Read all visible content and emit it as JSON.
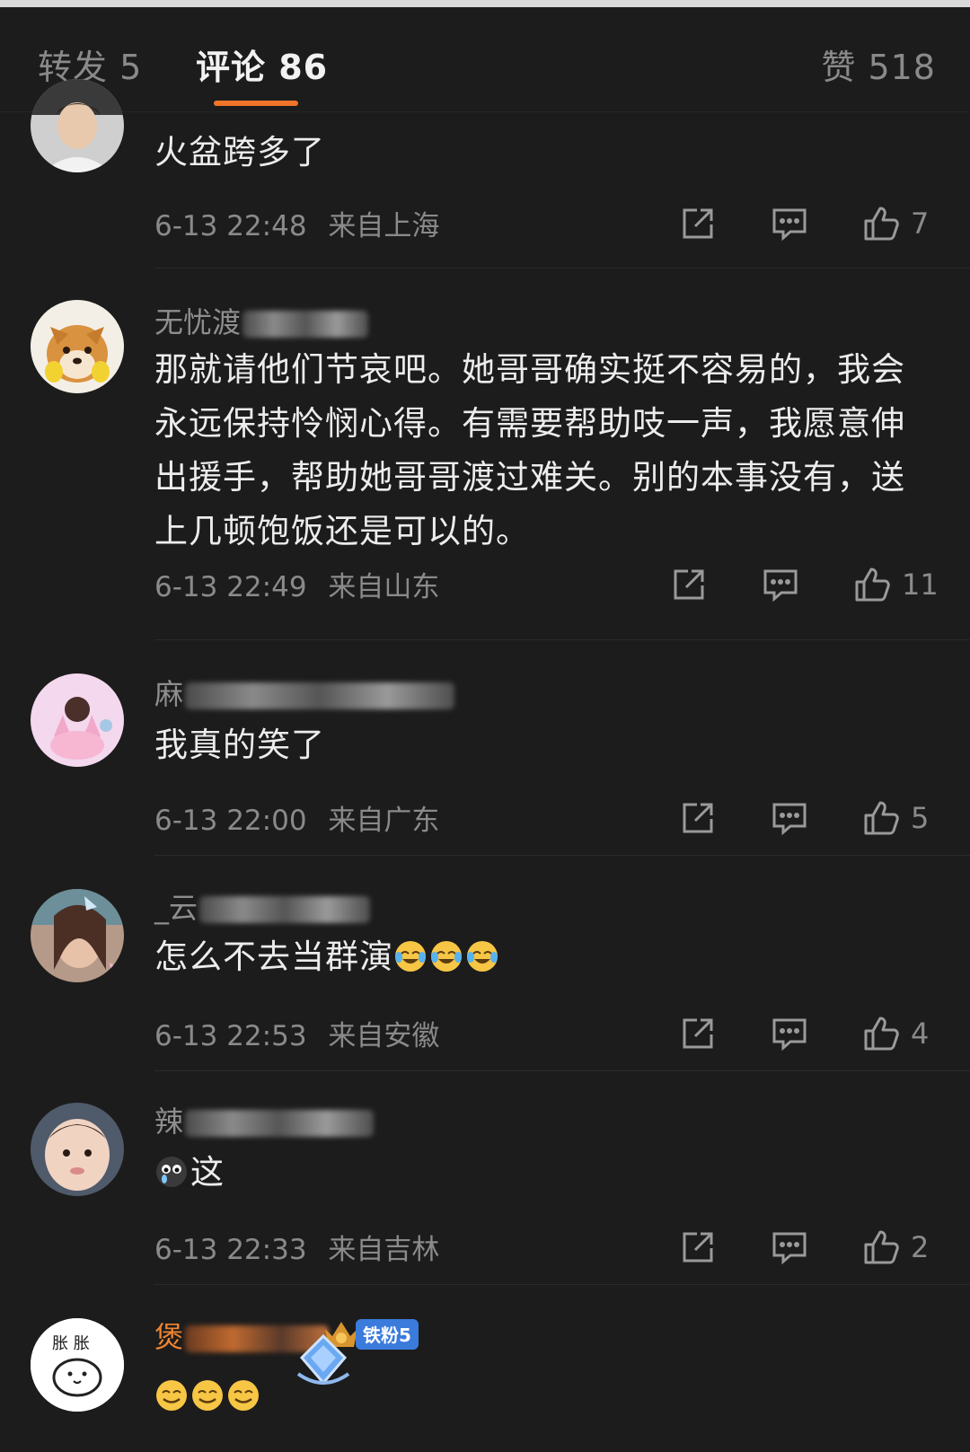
{
  "tabs": {
    "repost": "转发 5",
    "comments": "评论 86",
    "likes": "赞 518"
  },
  "comments": [
    {
      "username": "",
      "text": "火盆跨多了",
      "time": "6-13 22:48",
      "location": "来自上海",
      "likes": "7"
    },
    {
      "username": "无忧渡",
      "text": "那就请他们节哀吧。她哥哥确实挺不容易的，我会永远保持怜悯心得。有需要帮助吱一声，我愿意伸出援手，帮助她哥哥渡过难关。别的本事没有，送上几顿饱饭还是可以的。",
      "time": "6-13 22:49",
      "location": "来自山东",
      "likes": "11"
    },
    {
      "username": "麻",
      "text": "我真的笑了",
      "time": "6-13 22:00",
      "location": "来自广东",
      "likes": "5"
    },
    {
      "username": "_云",
      "text": "怎么不去当群演",
      "time": "6-13 22:53",
      "location": "来自安徽",
      "likes": "4"
    },
    {
      "username": "辣",
      "text": "这",
      "time": "6-13 22:33",
      "location": "来自吉林",
      "likes": "2"
    },
    {
      "username": "煲",
      "badge": "铁粉5",
      "avatar_text": "胀 胀"
    }
  ],
  "colors": {
    "background": "#1c1c1c",
    "accent": "#f0742a",
    "muted_text": "#8a8a8a",
    "vip_name": "#f0852f",
    "badge": "#3a7bdc"
  }
}
